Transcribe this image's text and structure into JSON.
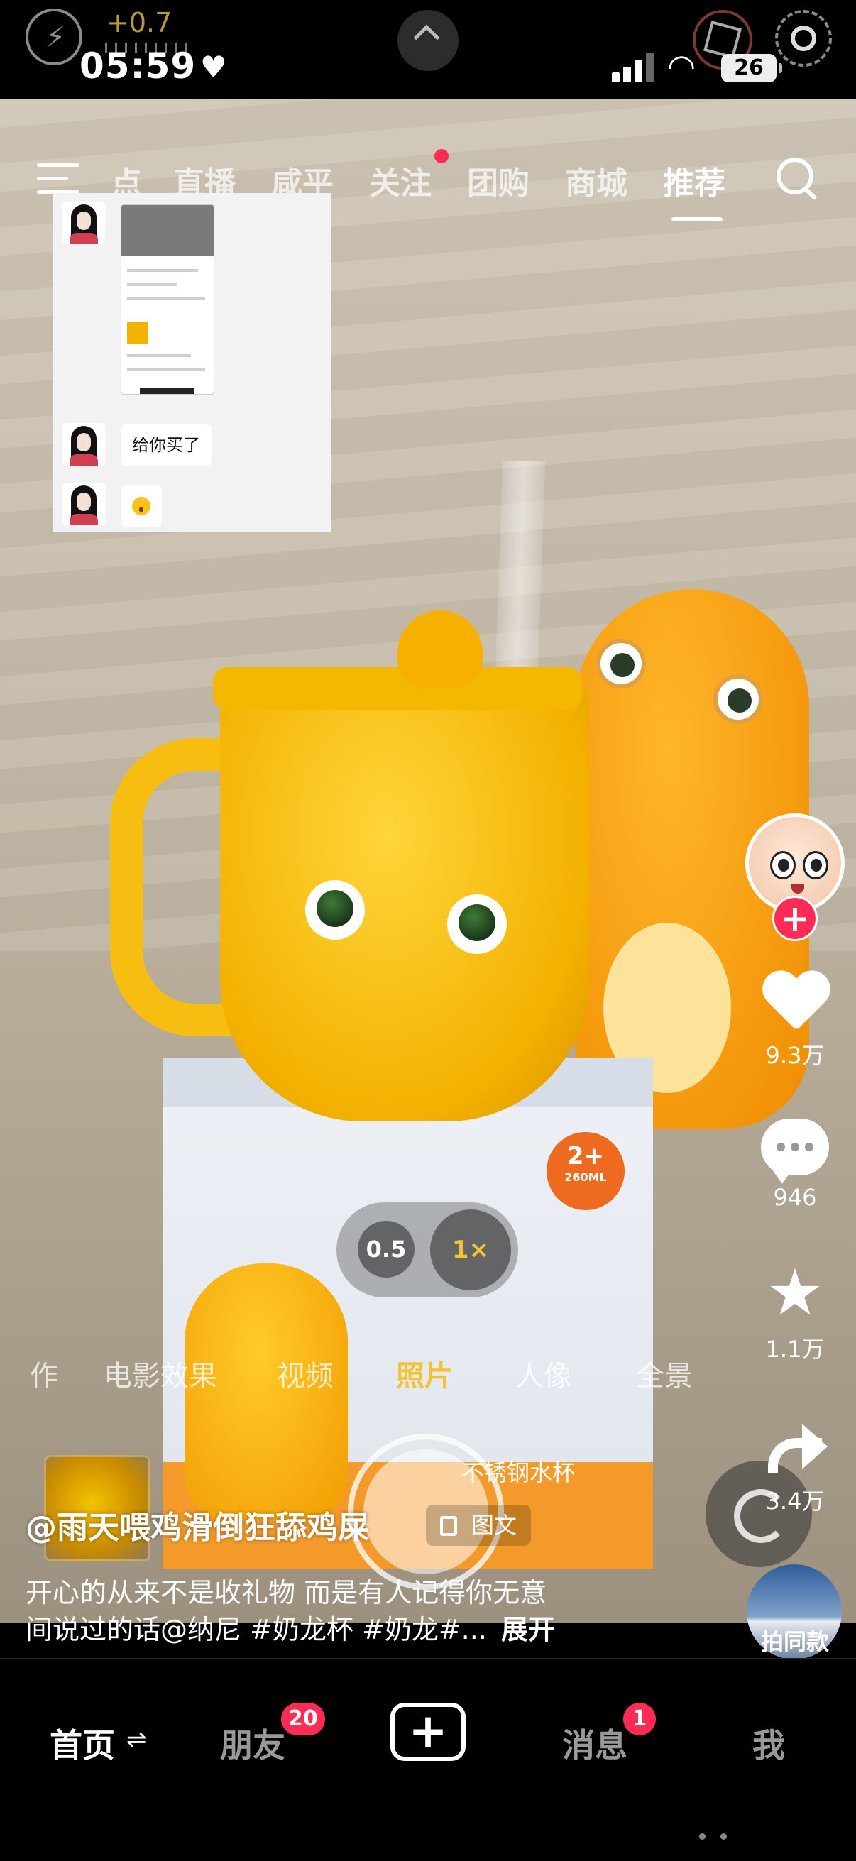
{
  "status_bar": {
    "exposure": "+0.7",
    "time": "05:59",
    "battery": "26",
    "icons": [
      "flash-off-icon",
      "heart-icon",
      "chevron-up-icon",
      "live-photo-icon",
      "target-icon",
      "signal-icon",
      "wifi-icon",
      "battery-icon"
    ]
  },
  "top_nav": {
    "tabs": [
      {
        "label": "点"
      },
      {
        "label": "直播"
      },
      {
        "label": "咸平"
      },
      {
        "label": "关注"
      },
      {
        "label": "团购"
      },
      {
        "label": "商城"
      },
      {
        "label": "推荐",
        "active": true
      }
    ],
    "has_new_dot_on": "关注"
  },
  "chat_overlay": {
    "messages": [
      {
        "type": "image"
      },
      {
        "type": "text",
        "text": "给你买了"
      },
      {
        "type": "emoji"
      }
    ]
  },
  "product_box": {
    "age_badge_main": "2+",
    "age_badge_sub": "260ML",
    "band_text": "不锈钢水杯"
  },
  "actions": {
    "likes": "9.3万",
    "comments": "946",
    "favorites": "1.1万",
    "shares": "3.4万",
    "same_style": "拍同款"
  },
  "camera": {
    "zoom_options": [
      "0.5",
      "1×"
    ],
    "zoom_selected": "1×",
    "modes": [
      "作",
      "电影效果",
      "视频",
      "照片",
      "人像",
      "全景"
    ],
    "mode_selected": "照片"
  },
  "post": {
    "author": "@雨天喂鸡滑倒狂舔鸡屎",
    "type_badge": "图文",
    "desc_line1": "开心的从来不是收礼物 而是有人记得你无意",
    "desc_line2": "间说过的话@纳尼 #奶龙杯 #奶龙#...",
    "expand": "展开"
  },
  "bottom_nav": {
    "home": "首页",
    "friends": "朋友",
    "friends_badge": "20",
    "post_button": "+",
    "messages": "消息",
    "messages_badge": "1",
    "me": "我"
  },
  "colors": {
    "accent_red": "#fe2c55",
    "camera_yellow": "#f1c232",
    "mug_yellow": "#f3b100"
  }
}
